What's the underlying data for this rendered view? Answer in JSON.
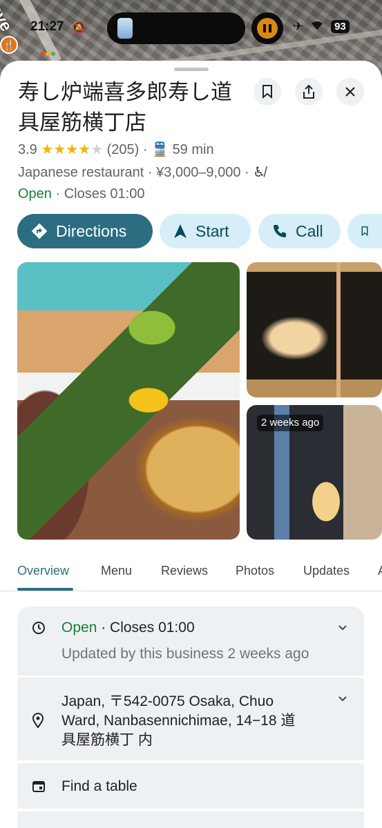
{
  "status_bar": {
    "time": "21:27",
    "battery": "93",
    "icons": [
      "bell-slash-icon",
      "airplane-icon",
      "wifi-icon",
      "battery-icon"
    ]
  },
  "map": {
    "label": "ave"
  },
  "place": {
    "name": "寿し炉端喜多郎寿し道具屋筋横丁店",
    "rating": "3.9",
    "stars_filled": 4,
    "review_count": "(205)",
    "transit_time": "59 min",
    "category": "Japanese restaurant",
    "price": "¥3,000–9,000",
    "open_status": "Open",
    "closes": "· Closes 01:00"
  },
  "actions": {
    "directions": "Directions",
    "start": "Start",
    "call": "Call"
  },
  "photos": {
    "badge": "2 weeks ago"
  },
  "tabs": [
    "Overview",
    "Menu",
    "Reviews",
    "Photos",
    "Updates",
    "A"
  ],
  "info": {
    "hours_status": "Open",
    "hours_closes": "· Closes 01:00",
    "hours_updated": "Updated by this business 2 weeks ago",
    "address_line1": "Japan, 〒542-0075 Osaka, Chuo",
    "address_line2": "Ward, Nanbasennichimae, 14−18 道",
    "address_line3": "具屋筋横丁 内",
    "find_table": "Find a table"
  },
  "colors": {
    "accent": "#2c6d82",
    "chip_secondary": "#d6eef7",
    "open_green": "#188038",
    "star": "#f3b400",
    "card_bg": "#eef1f3"
  }
}
